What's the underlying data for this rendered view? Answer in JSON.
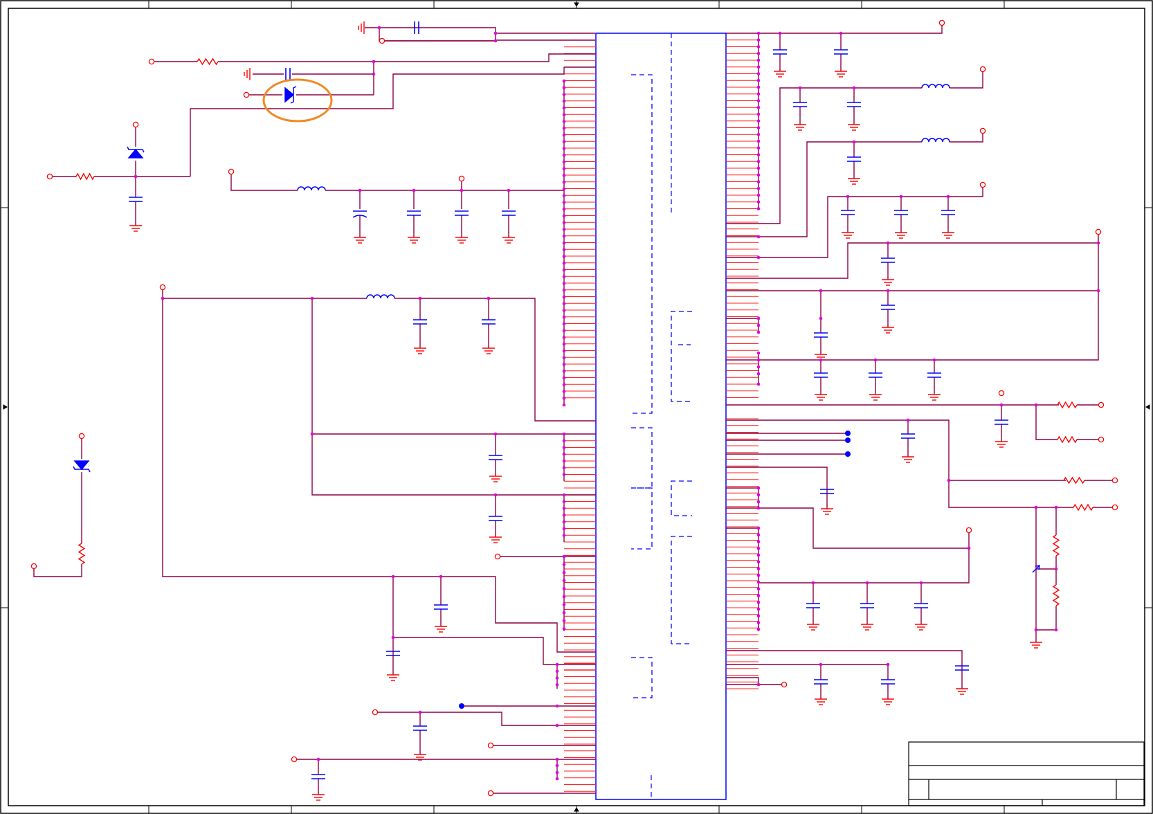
{
  "colors": {
    "background": "#ffffff",
    "frame": "#000000",
    "wire": "#8b0045",
    "pin": "#ff2020",
    "junction": "#e000e0",
    "component": "#0000ff",
    "ground": "#ff0000",
    "port": "#ff0000",
    "highlight": "#f08a24",
    "net_dot": "#0000ff"
  },
  "title_block": {
    "title": "",
    "sheet": ""
  },
  "icons": {
    "ground": "ground-icon",
    "capacitor": "capacitor-icon",
    "resistor": "resistor-icon",
    "inductor": "inductor-icon",
    "diode": "diode-icon",
    "port": "port-circle-icon"
  },
  "highlighted_component": "diode-icon"
}
